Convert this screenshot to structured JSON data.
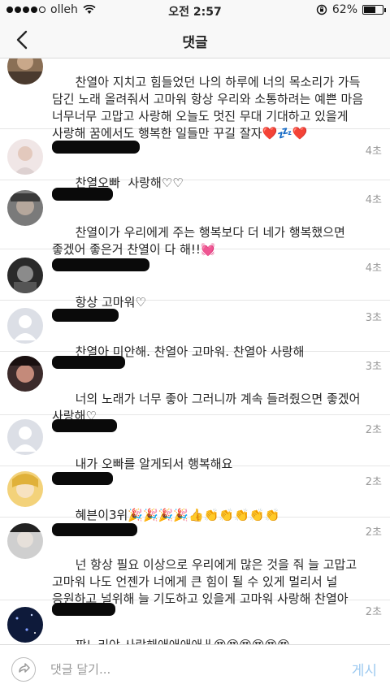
{
  "status": {
    "carrier": "olleh",
    "time": "오전 2:57",
    "battery": "62%",
    "battery_level": 0.62
  },
  "nav": {
    "title": "댓글"
  },
  "comments": [
    {
      "time": "",
      "text": "찬열아 지치고 힘들었던 나의 하루에 너의 목소리가 가득 담긴 노래 올려줘서 고마워 항상 우리와 소통하려는 예쁜 마음 너무너무 고맙고 사랑해 오늘도 멋진 무대 기대하고 있을게 사랑해 꿈에서도 행복한 일들만 꾸길 잘자",
      "emoji": "❤️💤❤️"
    },
    {
      "time": "4초",
      "text": "찬열오빠  사랑해♡♡",
      "emoji": ""
    },
    {
      "time": "4초",
      "text": "찬열이가 우리에게 주는 행복보다 더 네가 행복했으면 좋겠어 좋은거 찬열이 다 해!!",
      "emoji": "💓"
    },
    {
      "time": "4초",
      "text": "항상 고마워♡",
      "emoji": ""
    },
    {
      "time": "3초",
      "text": "찬열아 미안해. 찬열아 고마워. 찬열아 사랑해",
      "emoji": ""
    },
    {
      "time": "3초",
      "text": "너의 노래가 너무 좋아 그러니까 계속 들려줬으면 좋겠어 사랑해♡",
      "emoji": ""
    },
    {
      "time": "2초",
      "text": "내가 오빠를 알게되서 행복해요",
      "emoji": ""
    },
    {
      "time": "2초",
      "text": "혜븐이3위",
      "emoji": "🎉🎉🎉🎉👍👏👏👏👏👏"
    },
    {
      "time": "2초",
      "text": "넌 항상 필요 이상으로 우리에게 많은 것을 줘 늘 고맙고 고마워 나도 언젠가 너에게 큰 힘이 될 수 있게 멀리서 널 응원하고 널위해 늘 기도하고 있을게 고마워 사랑해 찬열아",
      "emoji": ""
    },
    {
      "time": "2초",
      "text": "쨔뇨리야 사랑해애애애애ㅐ",
      "emoji": "😍😍😍😍😍😍"
    }
  ],
  "input": {
    "placeholder": "댓글 달기...",
    "post_label": "게시"
  }
}
